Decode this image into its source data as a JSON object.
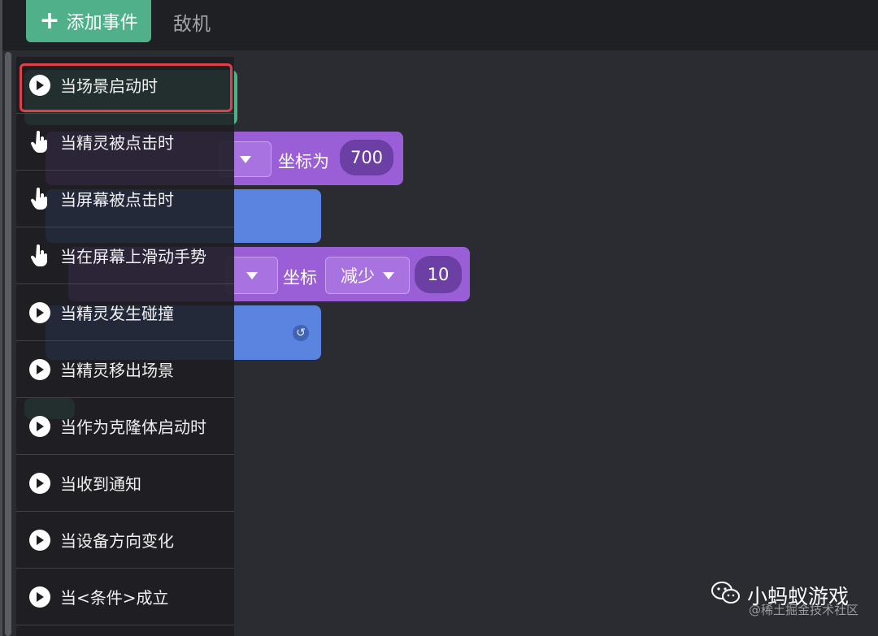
{
  "toolbar": {
    "add_event_label": "添加事件",
    "enemy_tab_label": "敌机"
  },
  "workspace": {
    "set_coord_label": "坐标为",
    "set_coord_value": "700",
    "change_coord_label": "坐标",
    "change_mode": "减少",
    "change_value": "10"
  },
  "menu": {
    "items": [
      {
        "label": "当场景启动时",
        "icon": "play-icon"
      },
      {
        "label": "当精灵被点击时",
        "icon": "hand-pointer-icon"
      },
      {
        "label": "当屏幕被点击时",
        "icon": "hand-pointer-icon"
      },
      {
        "label": "当在屏幕上滑动手势",
        "icon": "hand-pointer-icon"
      },
      {
        "label": "当精灵发生碰撞",
        "icon": "play-icon"
      },
      {
        "label": "当精灵移出场景",
        "icon": "play-icon"
      },
      {
        "label": "当作为克隆体启动时",
        "icon": "play-icon"
      },
      {
        "label": "当收到通知",
        "icon": "play-icon"
      },
      {
        "label": "当设备方向变化",
        "icon": "play-icon"
      },
      {
        "label": "当<条件>成立",
        "icon": "play-icon"
      }
    ],
    "selected_index": 0
  },
  "watermark": {
    "title": "小蚂蚁游戏",
    "subtitle": "@稀土掘金技术社区"
  },
  "colors": {
    "accent_green": "#4fb08a",
    "block_purple": "#9a5fd6",
    "block_blue": "#5b84e0",
    "highlight_red": "#e0404a"
  }
}
